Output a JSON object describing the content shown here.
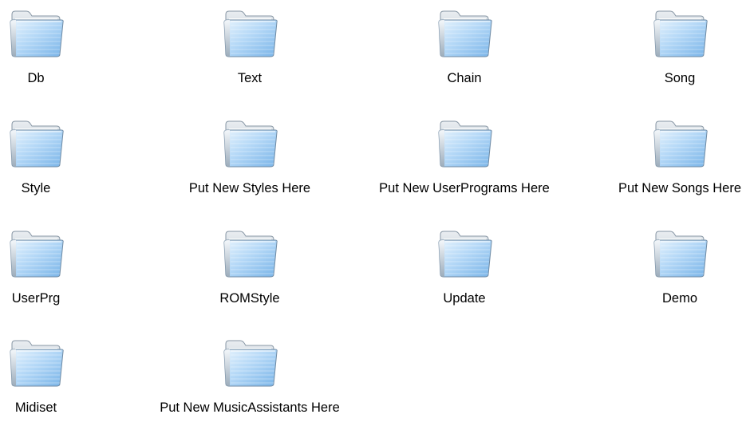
{
  "window": {
    "name": "folder-grid"
  },
  "folders": [
    {
      "label": "Db"
    },
    {
      "label": "Text"
    },
    {
      "label": "Chain"
    },
    {
      "label": "Song"
    },
    {
      "label": "Style"
    },
    {
      "label": "Put New Styles Here"
    },
    {
      "label": "Put New UserPrograms Here"
    },
    {
      "label": "Put New Songs Here"
    },
    {
      "label": "UserPrg"
    },
    {
      "label": "ROMStyle"
    },
    {
      "label": "Update"
    },
    {
      "label": "Demo"
    },
    {
      "label": "Midiset"
    },
    {
      "label": "Put New MusicAssistants Here"
    }
  ],
  "icon": "folder-icon",
  "colors": {
    "folder_light": "#dceefc",
    "folder_mid": "#a8d0f4",
    "folder_dark": "#5f9fd9",
    "folder_edge": "#7d8e9e"
  }
}
